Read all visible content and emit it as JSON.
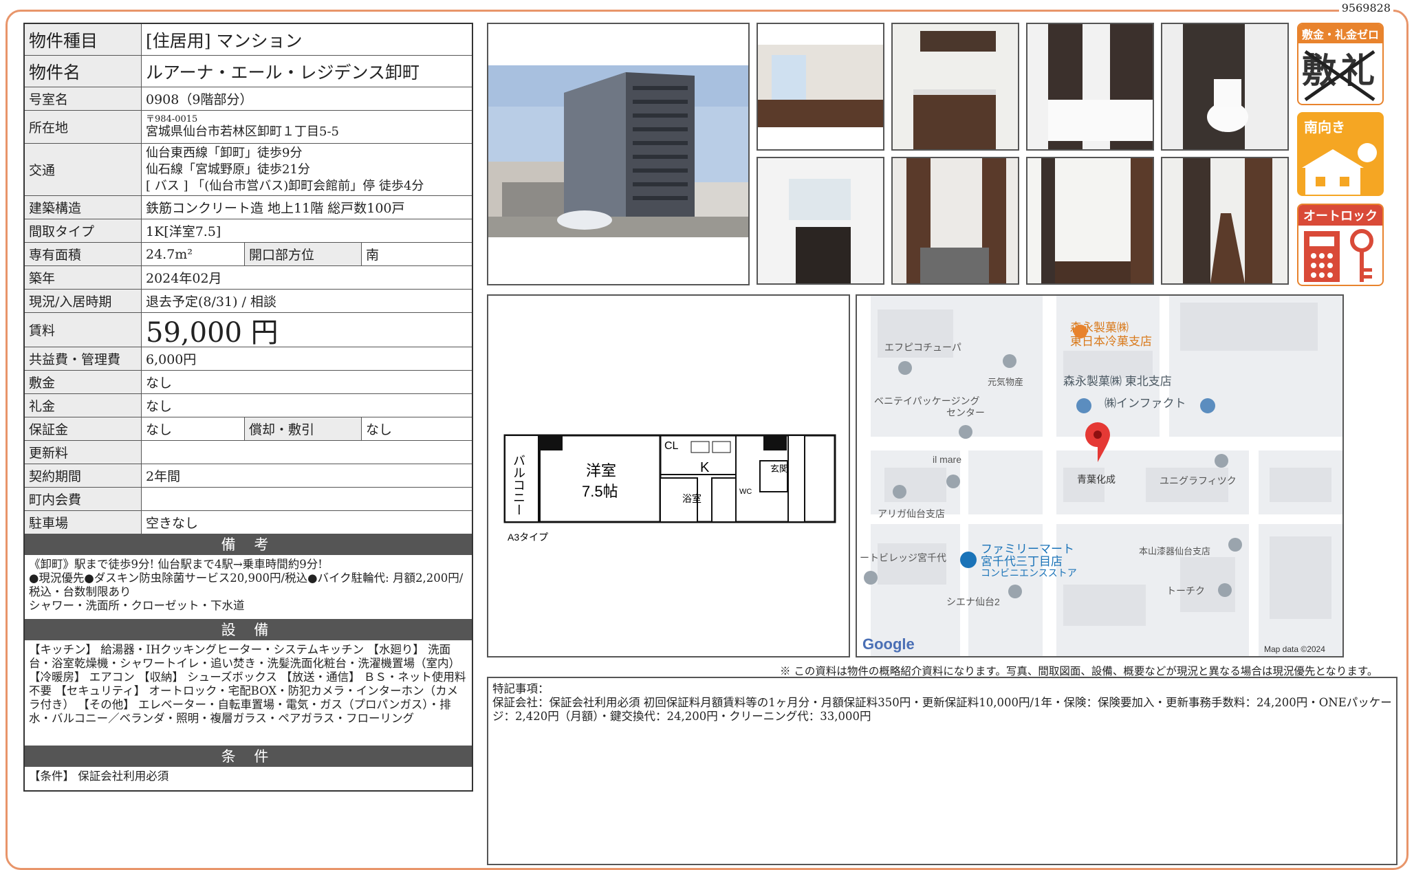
{
  "doc_id": "9569828",
  "property": {
    "type_label": "物件種目",
    "type_value": "[住居用] マンション",
    "name_label": "物件名",
    "name_value": "ルアーナ・エール・レジデンス卸町",
    "room_label": "号室名",
    "room_value": "0908（9階部分）",
    "address_label": "所在地",
    "postal": "〒984-0015",
    "address": "宮城県仙台市若林区卸町１丁目5-5",
    "transport_label": "交通",
    "transport": [
      "仙台東西線「卸町」徒歩9分",
      "仙石線「宮城野原」徒歩21分",
      "[ バス ] 「(仙台市営バス)卸町会館前」停 徒歩4分"
    ],
    "structure_label": "建築構造",
    "structure": "鉄筋コンクリート造 地上11階 総戸数100戸",
    "layout_label": "間取タイプ",
    "layout": "1K[洋室7.5]",
    "area_label": "専有面積",
    "area": "24.7m²",
    "direction_label": "開口部方位",
    "direction": "南",
    "built_label": "築年",
    "built": "2024年02月",
    "status_label": "現況/入居時期",
    "status": "退去予定(8/31) / 相談",
    "rent_label": "賃料",
    "rent": "59,000 円",
    "fee_label": "共益費・管理費",
    "fee": "6,000円",
    "deposit_label": "敷金",
    "deposit": "なし",
    "key_money_label": "礼金",
    "key_money": "なし",
    "guarantee_label": "保証金",
    "guarantee": "なし",
    "amort_label": "償却・敷引",
    "amort": "なし",
    "renewal_label": "更新料",
    "renewal": "",
    "contract_label": "契約期間",
    "contract": "2年間",
    "town_label": "町内会費",
    "town": "",
    "parking_label": "駐車場",
    "parking": "空きなし"
  },
  "remarks": {
    "title": "備 考",
    "text": "《卸町》駅まで徒歩9分! 仙台駅まで4駅→乗車時間約9分!\n●現況優先●ダスキン防虫除菌サービス20,900円/税込●バイク駐輪代: 月額2,200円/税込・台数制限あり\nシャワー・洗面所・クローゼット・下水道"
  },
  "facilities": {
    "title": "設 備",
    "text": "【キッチン】 給湯器・IHクッキングヒーター・システムキッチン 【水廻り】 洗面台・浴室乾燥機・シャワートイレ・追い焚き・洗髪洗面化粧台・洗濯機置場（室内） 【冷暖房】 エアコン 【収納】 シューズボックス 【放送・通信】 ＢＳ・ネット使用料不要 【セキュリティ】 オートロック・宅配BOX・防犯カメラ・インターホン（カメラ付き） 【その他】 エレベーター・自転車置場・電気・ガス（プロパンガス）・排水・バルコニー／ベランダ・照明・複層ガラス・ペアガラス・フローリング"
  },
  "conditions": {
    "title": "条 件",
    "text": "【条件】 保証会社利用必須"
  },
  "badges": {
    "b1_title": "敷金・礼金ゼロ",
    "b1_chars": "敷礼",
    "b2_title": "南向き",
    "b3_title": "オートロック"
  },
  "floorplan": {
    "balcony": "バルコニー",
    "room": "洋室",
    "room_size": "7.5帖",
    "cl": "CL",
    "k": "K",
    "bath": "浴室",
    "wc": "WC",
    "entry": "玄関",
    "type": "A3タイプ"
  },
  "map": {
    "labels": [
      "森永製菓㈱",
      "東日本冷菓支店",
      "エフピコチューパ",
      "元気物産",
      "森永製菓㈱ 東北支店",
      "㈱インファクト",
      "ベニテイパッケージング",
      "センター",
      "il mare",
      "青葉化成",
      "ユニグラフィツク",
      "アリガ仙台支店",
      "ファミリーマート",
      "宮千代三丁目店",
      "コンビニエンスストア",
      "ートビレッジ宮千代",
      "本山漆器仙台支店",
      "シエナ仙台2",
      "トーチク"
    ],
    "logo": "Google",
    "copyright": "Map data ©2024"
  },
  "note": "※ この資料は物件の概略紹介資料になります。写真、間取図面、設備、概要などが現況と異なる場合は現況優先となります。",
  "special": {
    "title": "特記事項：",
    "text": "保証会社：保証会社利用必須 初回保証料月額賃料等の1ヶ月分・月額保証料350円・更新保証料10,000円/1年・保険：保険要加入・更新事務手数料：24,200円・ONEパッケージ：2,420円（月額）・鍵交換代：24,200円・クリーニング代：33,000円"
  }
}
